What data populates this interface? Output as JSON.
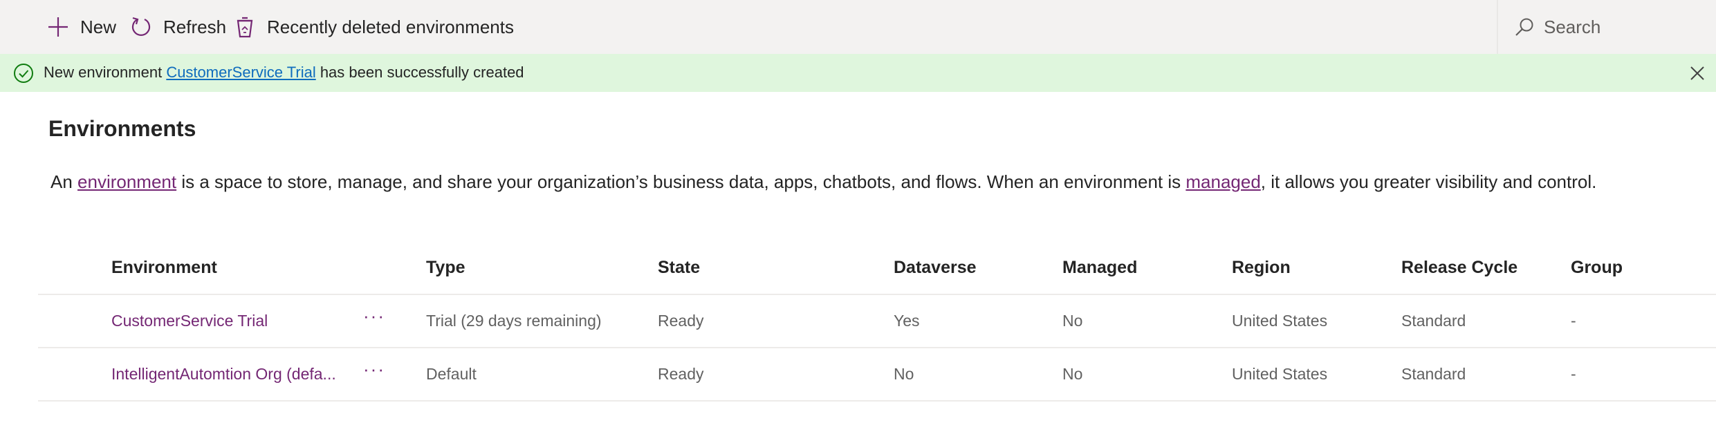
{
  "toolbar": {
    "new_label": "New",
    "refresh_label": "Refresh",
    "deleted_label": "Recently deleted environments",
    "search_placeholder": "Search"
  },
  "banner": {
    "prefix": "New environment ",
    "link": "CustomerService Trial",
    "suffix": " has been successfully created"
  },
  "page": {
    "title": "Environments",
    "desc_1": "An ",
    "desc_link_1": "environment",
    "desc_2": " is a space to store, manage, and share your organization’s business data, apps, chatbots, and flows. When an environment is ",
    "desc_link_2": "managed",
    "desc_3": ", it allows you greater visibility and control."
  },
  "table": {
    "columns": [
      "Environment",
      "Type",
      "State",
      "Dataverse",
      "Managed",
      "Region",
      "Release Cycle",
      "Group"
    ],
    "more_label": "···",
    "rows": [
      {
        "environment": "CustomerService Trial",
        "type": "Trial (29 days remaining)",
        "state": "Ready",
        "dataverse": "Yes",
        "managed": "No",
        "region": "United States",
        "release": "Standard",
        "group": "-"
      },
      {
        "environment": "IntelligentAutomtion Org (defa...",
        "type": "Default",
        "state": "Ready",
        "dataverse": "No",
        "managed": "No",
        "region": "United States",
        "release": "Standard",
        "group": "-"
      }
    ]
  },
  "colors": {
    "accent": "#742774",
    "banner_bg": "#dff6dd",
    "success": "#107c10",
    "link_blue": "#0f6cbd"
  },
  "icons": {
    "new": "add-icon",
    "refresh": "refresh-icon",
    "deleted": "recycle-bin-icon",
    "search": "search-icon",
    "success": "checkmark-circle-icon",
    "close": "close-icon"
  }
}
